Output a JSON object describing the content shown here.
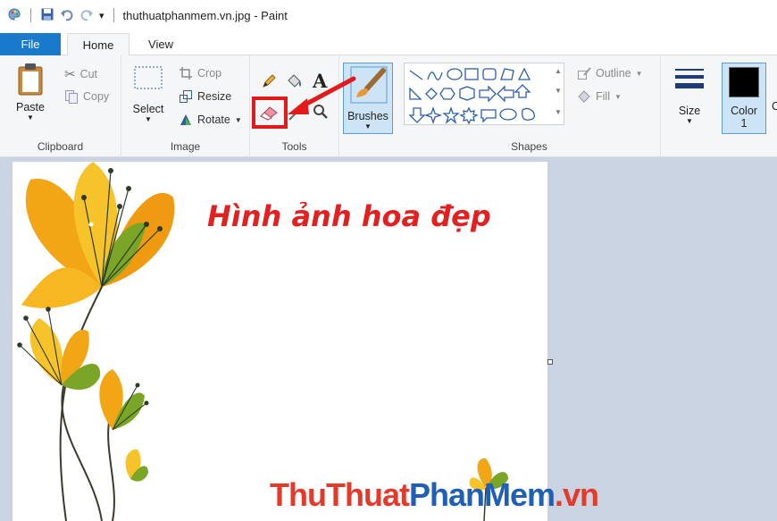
{
  "window": {
    "title": "thuthuatphanmem.vn.jpg - Paint"
  },
  "tabs": {
    "file": "File",
    "home": "Home",
    "view": "View"
  },
  "ribbon": {
    "clipboard": {
      "label": "Clipboard",
      "paste": "Paste",
      "cut": "Cut",
      "copy": "Copy"
    },
    "image": {
      "label": "Image",
      "select": "Select",
      "crop": "Crop",
      "resize": "Resize",
      "rotate": "Rotate"
    },
    "tools": {
      "label": "Tools",
      "text_glyph": "A"
    },
    "brushes": {
      "label": "Brushes"
    },
    "shapes": {
      "label": "Shapes",
      "outline": "Outline",
      "fill": "Fill"
    },
    "size": {
      "label": "Size"
    },
    "color1": {
      "label": "Color",
      "index": "1",
      "value": "#000000"
    }
  },
  "canvas": {
    "heading": "Hình ảnh hoa đẹp"
  },
  "watermark": {
    "part1": "Thu",
    "part2": "Thuat",
    "part3": "PhanMem",
    "part4": ".vn"
  },
  "colors": {
    "accent": "#1979ca",
    "highlight": "#e41f1f",
    "workspace": "#c9d3e2"
  }
}
